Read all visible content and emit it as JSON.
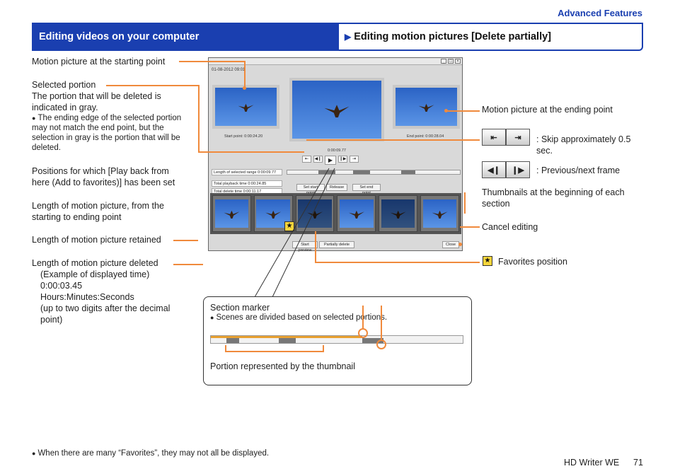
{
  "section_label": "Advanced Features",
  "header": {
    "left_title": "Editing videos on your computer",
    "right_marker": "▶",
    "right_title": "Editing motion pictures [Delete partially]"
  },
  "left_labels": {
    "start_point": "Motion picture at the starting point",
    "selected_portion_title": "Selected portion",
    "selected_portion_desc": "The portion that will be deleted is indicated in gray.",
    "selected_portion_note": "The ending edge of the selected portion may not match the end point, but the selection in gray is the portion that will be deleted.",
    "favorites_positions": "Positions for which [Play back from here (Add to favorites)] has been set",
    "length_start_end": "Length of motion picture, from the starting to ending point",
    "length_retained": "Length of motion picture retained",
    "length_deleted": "Length of motion picture deleted",
    "example_title": "(Example of displayed time)",
    "example_value": "0:00:03.45",
    "example_format": "Hours:Minutes:Seconds",
    "example_note": "(up to two digits after the decimal point)"
  },
  "right_labels": {
    "end_point": "Motion picture at the ending point",
    "skip": ": Skip approximately 0.5 sec.",
    "frame": ": Previous/next frame",
    "thumbnails": "Thumbnails at the beginning of each section",
    "cancel": "Cancel editing",
    "favorites_pos": "Favorites position"
  },
  "icons": {
    "skip_back": "⇤",
    "skip_fwd": "⇥",
    "frame_back": "◀❙",
    "frame_fwd": "❙▶",
    "star": "★",
    "play": "▶"
  },
  "window": {
    "date": "01-08-2012 09:01",
    "start_point_label": "Start point: 0:00:24.20",
    "end_point_label": "End point: 0:00:28.04",
    "current_time": "0:00:09.77",
    "length_selected_label": "Length of selected range",
    "length_selected_value": "0:00:09.77",
    "total_playback_label": "Total playback time",
    "total_playback_value": "0:00:24.85",
    "total_delete_label": "Total delete time",
    "total_delete_value": "0:00:11.17",
    "set_start_btn": "Set start point",
    "release_btn": "Release",
    "set_end_btn": "Set end point",
    "preview_btn": "Start preview",
    "partially_delete_btn": "Partially delete",
    "close_btn": "Close"
  },
  "callout": {
    "section_marker": "Section marker",
    "section_note": "Scenes are divided based on selected portions.",
    "portion_label": "Portion represented by the thumbnail"
  },
  "footer": {
    "note": "When there are many “Favorites”, they may not all be displayed.",
    "product": "HD Writer WE",
    "page": "71"
  },
  "colors": {
    "brand_blue": "#1a3fb0",
    "callout_orange": "#f08a3c"
  }
}
